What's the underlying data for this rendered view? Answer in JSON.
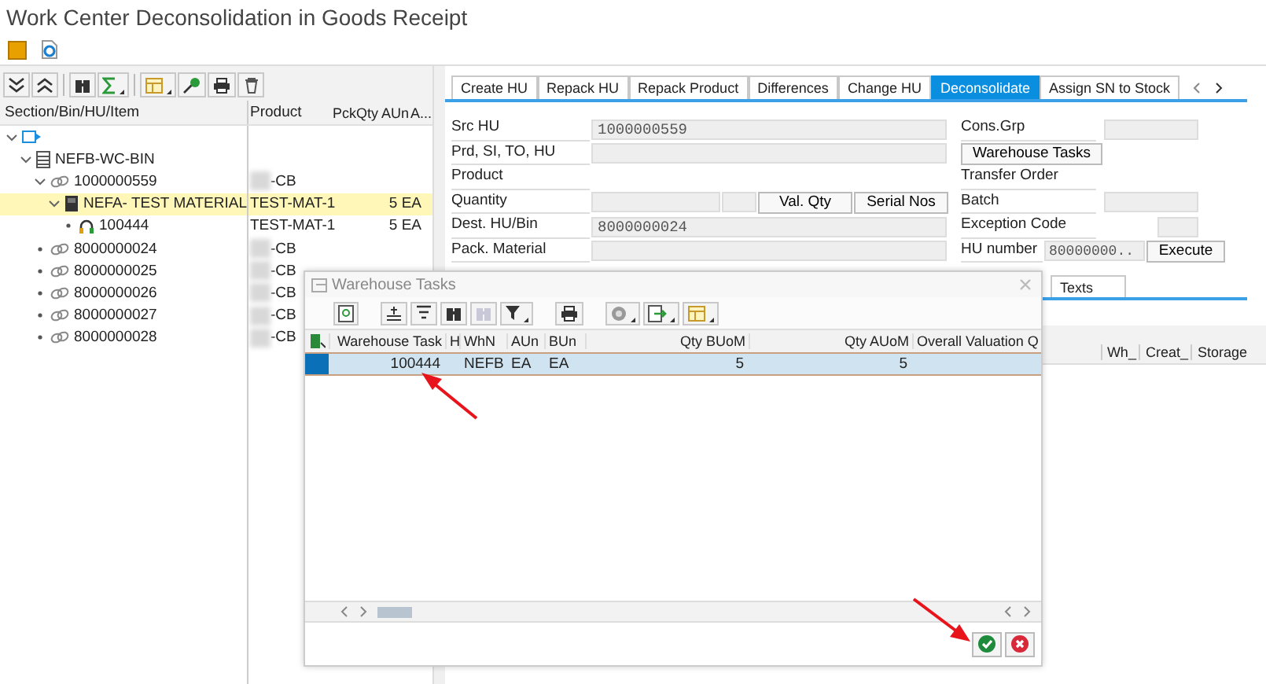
{
  "window": {
    "title": "Work Center Deconsolidation in Goods Receipt"
  },
  "left_panel": {
    "columns": [
      "Section/Bin/HU/Item",
      "Product",
      "PckQty AUn",
      "A..."
    ],
    "tree": [
      {
        "kind": "root",
        "expanded": true,
        "selected": false,
        "children": [
          {
            "kind": "bin",
            "label": "NEFB-WC-BIN",
            "expanded": true,
            "selected": false,
            "children": [
              {
                "kind": "hu",
                "label": "1000000559",
                "product": "-CB",
                "expanded": true,
                "selected": false,
                "children": [
                  {
                    "kind": "material",
                    "label": "NEFA- TEST MATERIAL",
                    "product": "TEST-MAT-1",
                    "qty": "5 EA",
                    "expanded": true,
                    "selected": true,
                    "children": [
                      {
                        "kind": "task",
                        "label": "100444",
                        "product": "TEST-MAT-1",
                        "qty": "5 EA",
                        "selected": false
                      }
                    ]
                  }
                ]
              },
              {
                "kind": "hu",
                "label": "8000000024",
                "product": "-CB",
                "selected": false
              },
              {
                "kind": "hu",
                "label": "8000000025",
                "product": "-CB",
                "selected": false
              },
              {
                "kind": "hu",
                "label": "8000000026",
                "product": "-CB",
                "selected": false
              },
              {
                "kind": "hu",
                "label": "8000000027",
                "product": "-CB",
                "selected": false
              },
              {
                "kind": "hu",
                "label": "8000000028",
                "product": "-CB",
                "selected": false
              }
            ]
          }
        ]
      }
    ]
  },
  "right_panel": {
    "tabs": [
      {
        "label": "Create HU",
        "selected": false
      },
      {
        "label": "Repack HU",
        "selected": false
      },
      {
        "label": "Repack Product",
        "selected": false
      },
      {
        "label": "Differences",
        "selected": false
      },
      {
        "label": "Change HU",
        "selected": false
      },
      {
        "label": "Deconsolidate",
        "selected": true
      },
      {
        "label": "Assign SN to Stock",
        "selected": false
      }
    ],
    "form_left": [
      {
        "kind": "field",
        "label": "Src HU",
        "value": "1000000559"
      },
      {
        "kind": "field",
        "label": "Prd, SI, TO, HU"
      },
      {
        "kind": "label",
        "label": "Product"
      },
      {
        "kind": "quantity",
        "label": "Quantity",
        "buttons": [
          "Val. Qty",
          "Serial Nos"
        ]
      },
      {
        "kind": "field",
        "label": "Dest. HU/Bin",
        "value": "8000000024"
      },
      {
        "kind": "field",
        "label": "Pack. Material"
      }
    ],
    "form_right": [
      {
        "kind": "field",
        "label": "Cons.Grp"
      },
      {
        "kind": "button",
        "button": "Warehouse Tasks"
      },
      {
        "kind": "label",
        "label": "Transfer Order"
      },
      {
        "kind": "field",
        "label": "Batch"
      },
      {
        "kind": "small_field",
        "label": "Exception Code"
      },
      {
        "kind": "execute",
        "label": "HU number",
        "value": "80000000..",
        "button": "Execute"
      }
    ],
    "lower_tabs": [
      {
        "label": "Texts",
        "selected": false
      }
    ],
    "lower_columns": [
      "Wh_",
      "Creat_",
      "Storage"
    ]
  },
  "dialog": {
    "title": "Warehouse Tasks",
    "columns": [
      "Warehouse Task",
      "H",
      "WhN",
      "AUn",
      "BUn",
      "Qty BUoM",
      "Qty AUoM",
      "Overall Valuation Q"
    ],
    "rows": [
      {
        "selected": true,
        "cells": [
          "100444",
          "",
          "NEFB",
          "EA",
          "EA",
          "5",
          "5",
          ""
        ]
      }
    ]
  },
  "annotations": [
    {
      "kind": "arrow"
    },
    {
      "kind": "arrow"
    }
  ]
}
